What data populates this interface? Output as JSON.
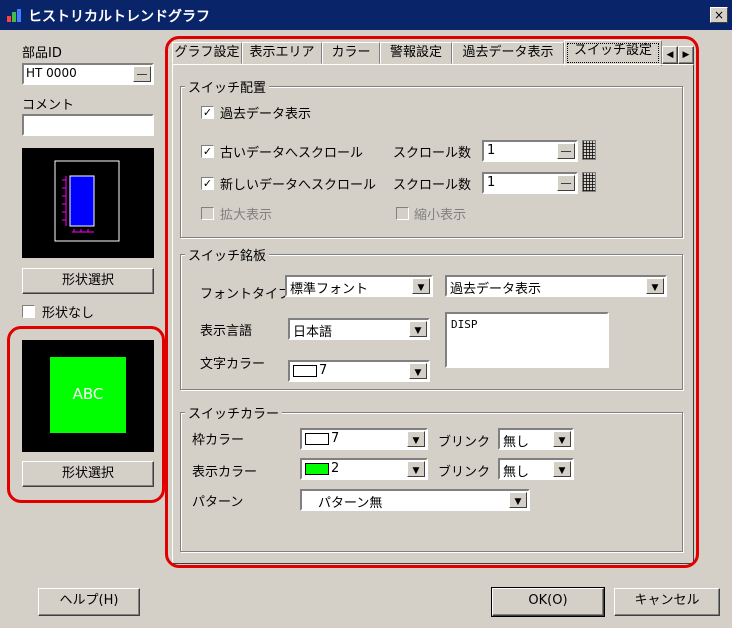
{
  "window": {
    "title": "ヒストリカルトレンドグラフ",
    "close_label": "×"
  },
  "left": {
    "part_id_label": "部品ID",
    "part_id_value": "HT 0000",
    "comment_label": "コメント",
    "comment_value": "",
    "shape_select_1": "形状選択",
    "no_shape_label": "形状なし",
    "preview_text": "ABC",
    "shape_select_2": "形状選択"
  },
  "tabs": [
    "グラフ設定",
    "表示エリア",
    "カラー",
    "警報設定",
    "過去データ表示",
    "スイッチ設定"
  ],
  "tab_scroll": {
    "left": "◀",
    "right": "▶"
  },
  "switch_placement": {
    "title": "スイッチ配置",
    "past_data": "過去データ表示",
    "scroll_old": "古いデータへスクロール",
    "scroll_new": "新しいデータへスクロール",
    "scroll_count_label": "スクロール数",
    "scroll_count_old": "1",
    "scroll_count_new": "1",
    "zoom_in": "拡大表示",
    "zoom_out": "縮小表示"
  },
  "switch_plate": {
    "title": "スイッチ銘板",
    "font_type_label": "フォントタイプ",
    "font_type_value": "標準フォント",
    "text_select_value": "過去データ表示",
    "language_label": "表示言語",
    "language_value": "日本語",
    "label_text": "DISP",
    "text_color_label": "文字カラー",
    "text_color_value": "7"
  },
  "switch_color": {
    "title": "スイッチカラー",
    "frame_color_label": "枠カラー",
    "frame_color_value": "7",
    "blink_label": "ブリンク",
    "blink_1_value": "無し",
    "display_color_label": "表示カラー",
    "display_color_value": "2",
    "blink_2_value": "無し",
    "pattern_label": "パターン",
    "pattern_value": "パターン無"
  },
  "footer": {
    "help": "ヘルプ(H)",
    "ok": "OK(O)",
    "cancel": "キャンセル"
  },
  "colors": {
    "title_bar": "#0a246a",
    "highlight": "#e00000",
    "preview_green": "#00ff00",
    "dialog": "#d4d0c8"
  }
}
